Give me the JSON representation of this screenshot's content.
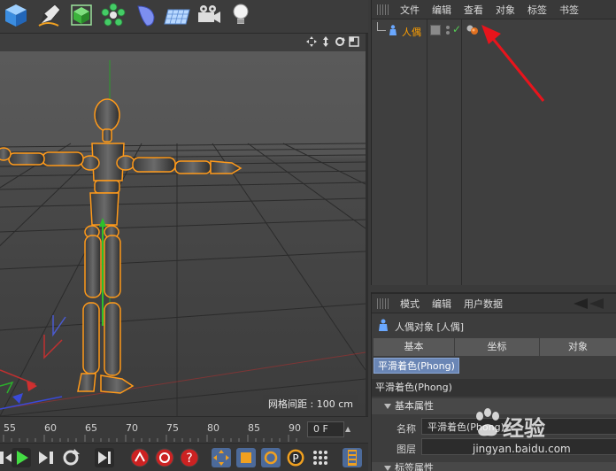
{
  "toolbar": {
    "tools": [
      {
        "icon": "cube-icon"
      },
      {
        "icon": "pen-icon"
      },
      {
        "icon": "subdivision-cube-icon"
      },
      {
        "icon": "array-flower-icon"
      },
      {
        "icon": "deformer-bend-icon"
      },
      {
        "icon": "floor-plane-icon"
      },
      {
        "icon": "camera-icon"
      },
      {
        "icon": "light-bulb-icon"
      }
    ]
  },
  "viewport": {
    "grid_info": "网格间距 : 100 cm"
  },
  "timeline": {
    "ticks": [
      "55",
      "60",
      "65",
      "70",
      "75",
      "80",
      "85",
      "90"
    ],
    "current_frame": "0 F"
  },
  "object_manager": {
    "menu": [
      "文件",
      "编辑",
      "查看",
      "对象",
      "标签",
      "书签"
    ],
    "object_name": "人偶"
  },
  "attribute_manager": {
    "menu": [
      "模式",
      "编辑",
      "用户数据"
    ],
    "title": "人偶对象 [人偶]",
    "tabs": [
      "基本",
      "坐标",
      "对象"
    ],
    "subtab": "平滑着色(Phong)",
    "section": "平滑着色(Phong)",
    "group_basic": "基本属性",
    "name_label": "名称",
    "name_value": "平滑着色(Phong)",
    "layer_label": "图层",
    "group_tag": "标签属性"
  },
  "watermark": {
    "brand": "经验",
    "url": "jingyan.baidu.com"
  },
  "colors": {
    "selection_orange": "#ff9a1a",
    "annotation_red": "#e8141c",
    "subtab_blue": "#6a86b5"
  }
}
